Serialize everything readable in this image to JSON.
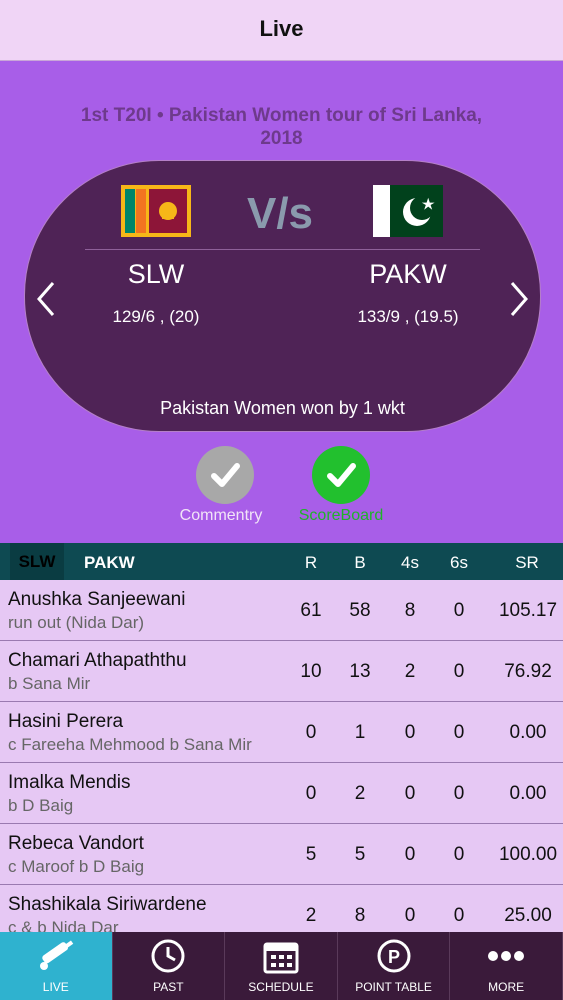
{
  "navbar": {
    "title": "Live"
  },
  "match": {
    "title": "1st T20I • Pakistan Women tour of Sri Lanka, 2018",
    "vs_label": "V/s",
    "team_a": {
      "name": "SLW",
      "score": "129/6 , (20)"
    },
    "team_b": {
      "name": "PAKW",
      "score": "133/9 , (19.5)"
    },
    "result": "Pakistan Women won by 1 wkt"
  },
  "toggles": {
    "commentary": "Commentry",
    "scoreboard": "ScoreBoard"
  },
  "scorecard": {
    "tab_a": "SLW",
    "tab_b": "PAKW",
    "headers": {
      "r": "R",
      "b": "B",
      "fours": "4s",
      "sixes": "6s",
      "sr": "SR"
    },
    "rows": [
      {
        "name": "Anushka Sanjeewani",
        "dismissal": "run out (Nida Dar)",
        "r": "61",
        "b": "58",
        "fours": "8",
        "sixes": "0",
        "sr": "105.17"
      },
      {
        "name": "Chamari Athapaththu",
        "dismissal": "b Sana Mir",
        "r": "10",
        "b": "13",
        "fours": "2",
        "sixes": "0",
        "sr": "76.92"
      },
      {
        "name": "Hasini Perera",
        "dismissal": "c Fareeha Mehmood b Sana Mir",
        "r": "0",
        "b": "1",
        "fours": "0",
        "sixes": "0",
        "sr": "0.00"
      },
      {
        "name": "Imalka Mendis",
        "dismissal": "b D Baig",
        "r": "0",
        "b": "2",
        "fours": "0",
        "sixes": "0",
        "sr": "0.00"
      },
      {
        "name": "Rebeca Vandort",
        "dismissal": "c Maroof b D Baig",
        "r": "5",
        "b": "5",
        "fours": "0",
        "sixes": "0",
        "sr": "100.00"
      },
      {
        "name": "Shashikala Siriwardene",
        "dismissal": "c & b Nida Dar",
        "r": "2",
        "b": "8",
        "fours": "0",
        "sixes": "0",
        "sr": "25.00"
      }
    ]
  },
  "tabbar": [
    {
      "label": "LIVE",
      "icon": "cricket-bat-icon"
    },
    {
      "label": "PAST",
      "icon": "clock-icon"
    },
    {
      "label": "SCHEDULE",
      "icon": "calendar-icon"
    },
    {
      "label": "POINT TABLE",
      "icon": "point-table-icon"
    },
    {
      "label": "MORE",
      "icon": "more-icon"
    }
  ],
  "colors": {
    "accent": "#a85ee8",
    "oval": "#4f2356",
    "header": "#0e4a52",
    "active_tab": "#2fb2cf",
    "scoreboard_green": "#22c02e"
  }
}
